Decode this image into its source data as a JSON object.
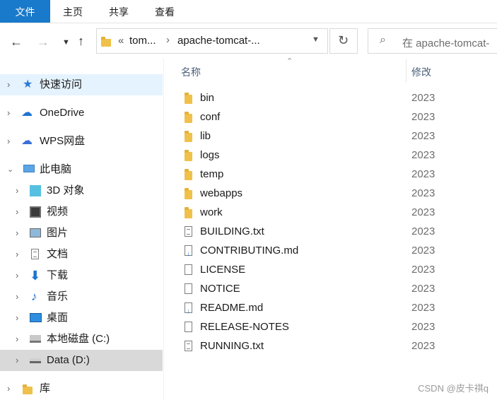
{
  "ribbon": {
    "file": "文件",
    "home": "主页",
    "share": "共享",
    "view": "查看"
  },
  "address": {
    "overflow": "«",
    "crumb1": "tom...",
    "crumb2": "apache-tomcat-..."
  },
  "search": {
    "placeholder": "在 apache-tomcat-"
  },
  "sidebar": {
    "quick_access": "快速访问",
    "onedrive": "OneDrive",
    "wps": "WPS网盘",
    "this_pc": "此电脑",
    "objects3d": "3D 对象",
    "videos": "视频",
    "pictures": "图片",
    "documents": "文档",
    "downloads": "下载",
    "music": "音乐",
    "desktop": "桌面",
    "drive_c": "本地磁盘 (C:)",
    "drive_d": "Data (D:)",
    "libraries": "库"
  },
  "columns": {
    "name": "名称",
    "modified": "修改"
  },
  "files": [
    {
      "name": "bin",
      "type": "folder",
      "date": "2023"
    },
    {
      "name": "conf",
      "type": "folder",
      "date": "2023"
    },
    {
      "name": "lib",
      "type": "folder",
      "date": "2023"
    },
    {
      "name": "logs",
      "type": "folder",
      "date": "2023"
    },
    {
      "name": "temp",
      "type": "folder",
      "date": "2023"
    },
    {
      "name": "webapps",
      "type": "folder",
      "date": "2023"
    },
    {
      "name": "work",
      "type": "folder",
      "date": "2023"
    },
    {
      "name": "BUILDING.txt",
      "type": "txt",
      "date": "2023"
    },
    {
      "name": "CONTRIBUTING.md",
      "type": "md",
      "date": "2023"
    },
    {
      "name": "LICENSE",
      "type": "file",
      "date": "2023"
    },
    {
      "name": "NOTICE",
      "type": "file",
      "date": "2023"
    },
    {
      "name": "README.md",
      "type": "md",
      "date": "2023"
    },
    {
      "name": "RELEASE-NOTES",
      "type": "file",
      "date": "2023"
    },
    {
      "name": "RUNNING.txt",
      "type": "txt",
      "date": "2023"
    }
  ],
  "watermark": "CSDN @皮卡祺q",
  "colors": {
    "accent": "#1979ca",
    "hover": "#e5f3ff",
    "selected": "#d9d9d9",
    "folder": "#f0c14a"
  }
}
